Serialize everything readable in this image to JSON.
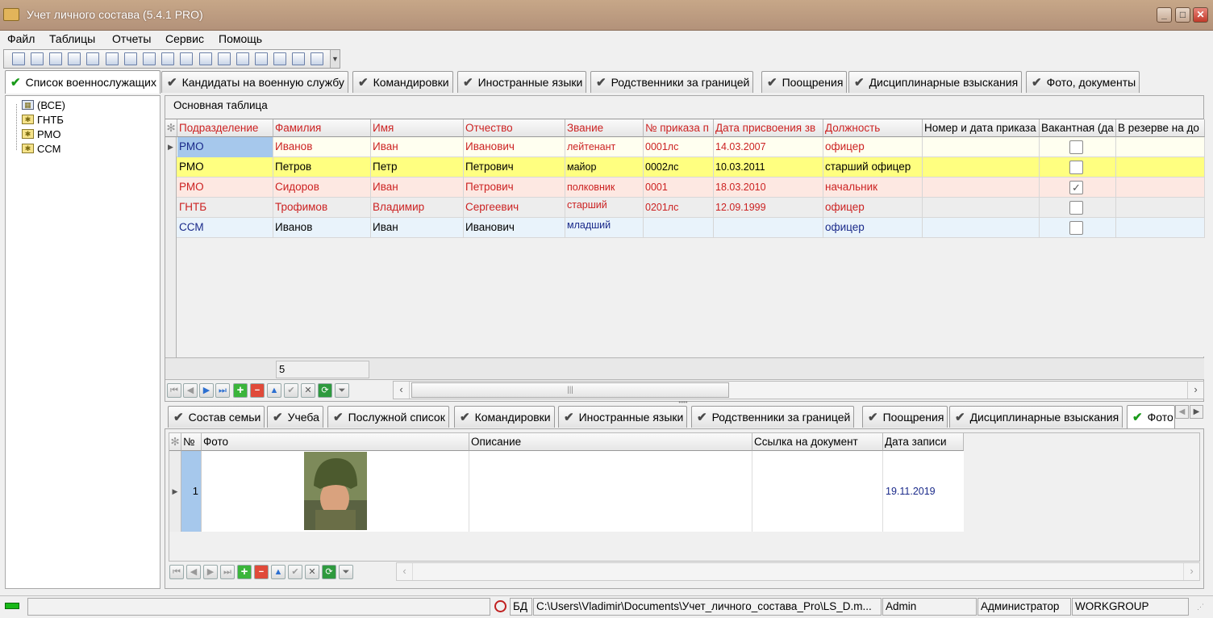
{
  "window": {
    "title": "Учет личного состава (5.4.1 PRO)"
  },
  "menu": [
    "Файл",
    "Таблицы",
    "Отчеты",
    "Сервис",
    "Помощь"
  ],
  "main_tabs": [
    "Список военнослужащих",
    "Кандидаты на военную службу",
    "Командировки",
    "Иностранные языки",
    "Родственники за границей",
    "Поощрения",
    "Дисциплинарные взыскания",
    "Фото, документы"
  ],
  "tree": {
    "items": [
      "(ВСЕ)",
      "ГНТБ",
      "РМО",
      "ССМ"
    ]
  },
  "main_table": {
    "title": "Основная таблица",
    "columns": [
      "Подразделение",
      "Фамилия",
      "Имя",
      "Отчество",
      "Звание",
      "№ приказа п",
      "Дата присвоения зв",
      "Должность",
      "Номер и дата приказа",
      "Вакантная (да",
      "В резерве на до"
    ],
    "rows": [
      {
        "cells": [
          "РМО",
          "Иванов",
          "Иван",
          "Иванович",
          "лейтенант",
          "0001лс",
          "14.03.2007",
          "офицер",
          ""
        ],
        "checked": false
      },
      {
        "cells": [
          "РМО",
          "Петров",
          "Петр",
          "Петрович",
          "майор",
          "0002лс",
          "10.03.2011",
          "старший офицер",
          ""
        ],
        "checked": false
      },
      {
        "cells": [
          "РМО",
          "Сидоров",
          "Иван",
          "Петрович",
          "полковник",
          "0001",
          "18.03.2010",
          "начальник",
          ""
        ],
        "checked": true
      },
      {
        "cells": [
          "ГНТБ",
          "Трофимов",
          "Владимир",
          "Сергеевич",
          "старший",
          "0201лс",
          "12.09.1999",
          "офицер",
          ""
        ],
        "checked": false
      },
      {
        "cells": [
          "ССМ",
          "Иванов",
          "Иван",
          "Иванович",
          "младший",
          "",
          "",
          "офицер",
          ""
        ],
        "checked": false
      }
    ],
    "count": "5"
  },
  "sub_tabs": [
    "Состав семьи",
    "Учеба",
    "Послужной список",
    "Командировки",
    "Иностранные языки",
    "Родственники за границей",
    "Поощрения",
    "Дисциплинарные взыскания",
    "Фото"
  ],
  "photo_table": {
    "columns": [
      "№",
      "Фото",
      "Описание",
      "Ссылка на документ",
      "Дата записи"
    ],
    "rows": [
      {
        "num": "1",
        "description": "",
        "link": "",
        "date": "19.11.2019"
      }
    ]
  },
  "status": {
    "db_label": "БД",
    "db_path": "C:\\Users\\Vladimir\\Documents\\Учет_личного_состава_Pro\\LS_D.m...",
    "user": "Admin",
    "role": "Администратор",
    "workgroup": "WORKGROUP"
  },
  "colors": {
    "row_yellow": "#ffff80",
    "row_pink": "#fde8e2",
    "row_gray": "#ededed",
    "row_blue": "#e9f3fb",
    "row_cream": "#fffff0",
    "text_red": "#cc2222",
    "text_navy": "#1a2a8a"
  }
}
